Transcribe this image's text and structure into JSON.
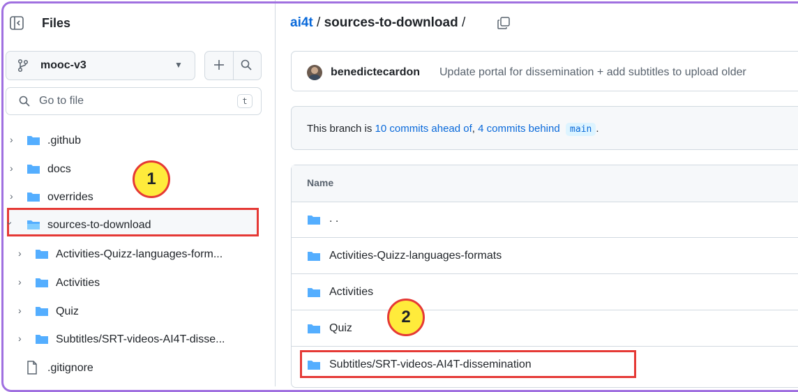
{
  "sidebar": {
    "title": "Files",
    "branch": "mooc-v3",
    "goto_placeholder": "Go to file",
    "goto_shortcut": "t",
    "tree": [
      {
        "label": ".github",
        "type": "folder",
        "level": 0,
        "expanded": false
      },
      {
        "label": "docs",
        "type": "folder",
        "level": 0,
        "expanded": false
      },
      {
        "label": "overrides",
        "type": "folder",
        "level": 0,
        "expanded": false
      },
      {
        "label": "sources-to-download",
        "type": "folder",
        "level": 0,
        "expanded": true,
        "selected": true
      },
      {
        "label": "Activities-Quizz-languages-form...",
        "type": "folder",
        "level": 1,
        "expanded": false
      },
      {
        "label": "Activities",
        "type": "folder",
        "level": 1,
        "expanded": false
      },
      {
        "label": "Quiz",
        "type": "folder",
        "level": 1,
        "expanded": false
      },
      {
        "label": "Subtitles/SRT-videos-AI4T-disse...",
        "type": "folder",
        "level": 1,
        "expanded": false
      },
      {
        "label": ".gitignore",
        "type": "file",
        "level": 0
      }
    ]
  },
  "breadcrumb": {
    "repo": "ai4t",
    "separator": "/",
    "current": "sources-to-download",
    "trailing": "/"
  },
  "commit": {
    "author": "benedictecardon",
    "message": "Update portal for dissemination + add subtitles to upload older"
  },
  "branch_status": {
    "prefix": "This branch is ",
    "ahead": "10 commits ahead of",
    "between": ", ",
    "behind": "4 commits behind",
    "base": "main",
    "suffix": "."
  },
  "table": {
    "header": "Name",
    "rows": [
      {
        "label": ". ."
      },
      {
        "label": "Activities-Quizz-languages-formats"
      },
      {
        "label": "Activities"
      },
      {
        "label": "Quiz"
      },
      {
        "label": "Subtitles/SRT-videos-AI4T-dissemination"
      }
    ]
  },
  "callouts": [
    "1",
    "2"
  ],
  "colors": {
    "link": "#0969da",
    "folder": "#54aeff",
    "highlight": "#e53935",
    "callout_fill": "#ffeb3b",
    "frame": "#a070e0"
  }
}
